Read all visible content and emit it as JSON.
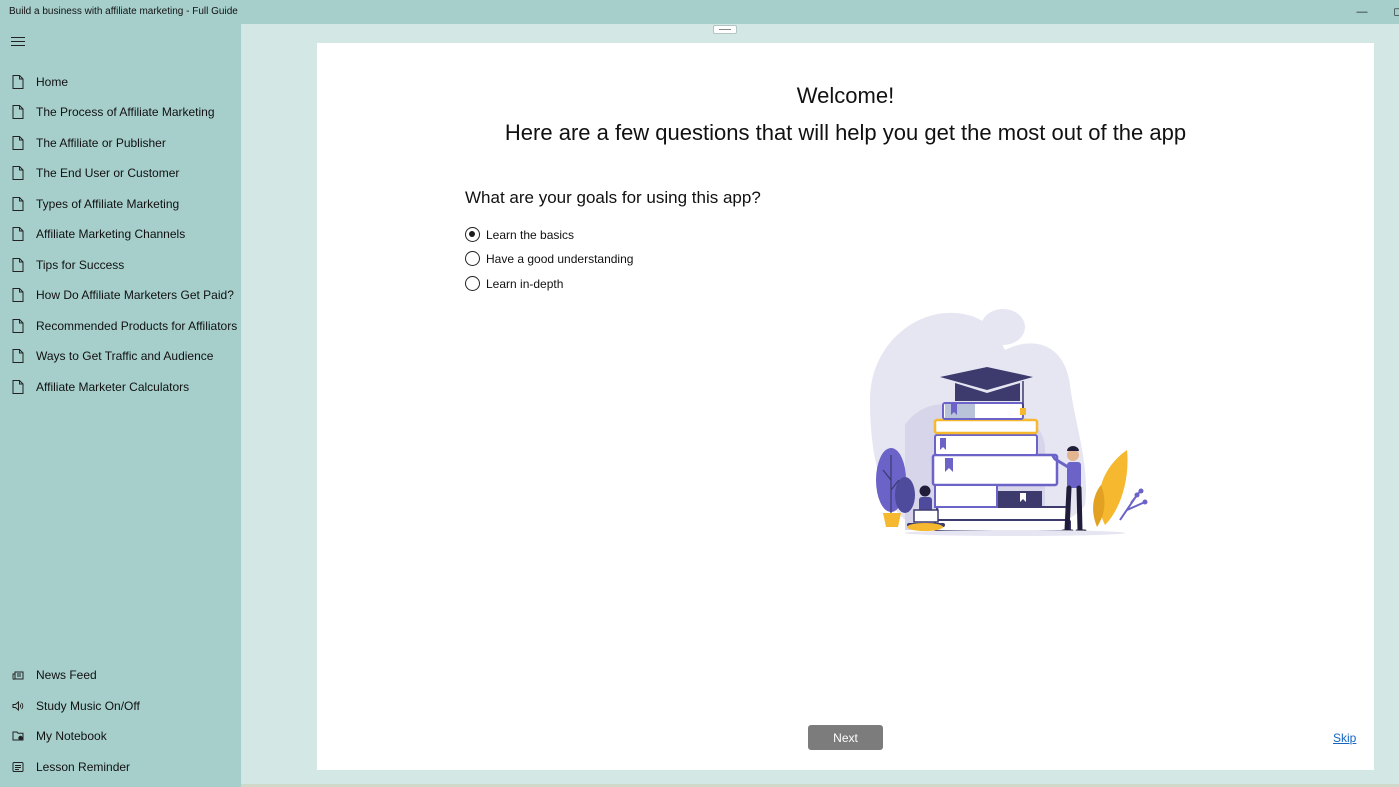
{
  "window": {
    "title": "Build a business with affiliate marketing - Full Guide",
    "minimize_glyph": "—",
    "maximize_glyph": "◻"
  },
  "sidebar": {
    "items": [
      {
        "label": "Home",
        "icon": "page-icon"
      },
      {
        "label": "The Process of Affiliate Marketing",
        "icon": "page-icon"
      },
      {
        "label": "The Affiliate or Publisher",
        "icon": "page-icon"
      },
      {
        "label": "The End User or Customer",
        "icon": "page-icon"
      },
      {
        "label": "Types of Affiliate Marketing",
        "icon": "page-icon"
      },
      {
        "label": "Affiliate Marketing Channels",
        "icon": "page-icon"
      },
      {
        "label": "Tips for Success",
        "icon": "page-icon"
      },
      {
        "label": "How Do Affiliate Marketers Get Paid?",
        "icon": "page-icon"
      },
      {
        "label": "Recommended Products for Affiliators",
        "icon": "page-icon"
      },
      {
        "label": "Ways to Get Traffic and Audience",
        "icon": "page-icon"
      },
      {
        "label": "Affiliate Marketer Calculators",
        "icon": "page-icon"
      }
    ],
    "bottom_items": [
      {
        "label": "News Feed",
        "icon": "news-icon"
      },
      {
        "label": "Study Music On/Off",
        "icon": "speaker-icon"
      },
      {
        "label": "My Notebook",
        "icon": "notebook-icon"
      },
      {
        "label": "Lesson Reminder",
        "icon": "reminder-icon"
      }
    ]
  },
  "main": {
    "welcome": "Welcome!",
    "subheading": "Here are a few questions that will help you get the most out of the app",
    "question": "What are your goals for using this app?",
    "options": [
      {
        "label": "Learn the basics",
        "selected": true
      },
      {
        "label": "Have a good understanding",
        "selected": false
      },
      {
        "label": "Learn in-depth",
        "selected": false
      }
    ],
    "next_label": "Next",
    "skip_label": "Skip"
  },
  "colors": {
    "sidebar_bg": "#a6cfcc",
    "content_bg": "#d3e7e4",
    "card_bg": "#ffffff",
    "button_bg": "#7c7c7c",
    "link": "#1565c0",
    "illustration_navy": "#3d3b6e",
    "illustration_accent": "#f5b82e",
    "illustration_purple": "#6b63c7"
  }
}
